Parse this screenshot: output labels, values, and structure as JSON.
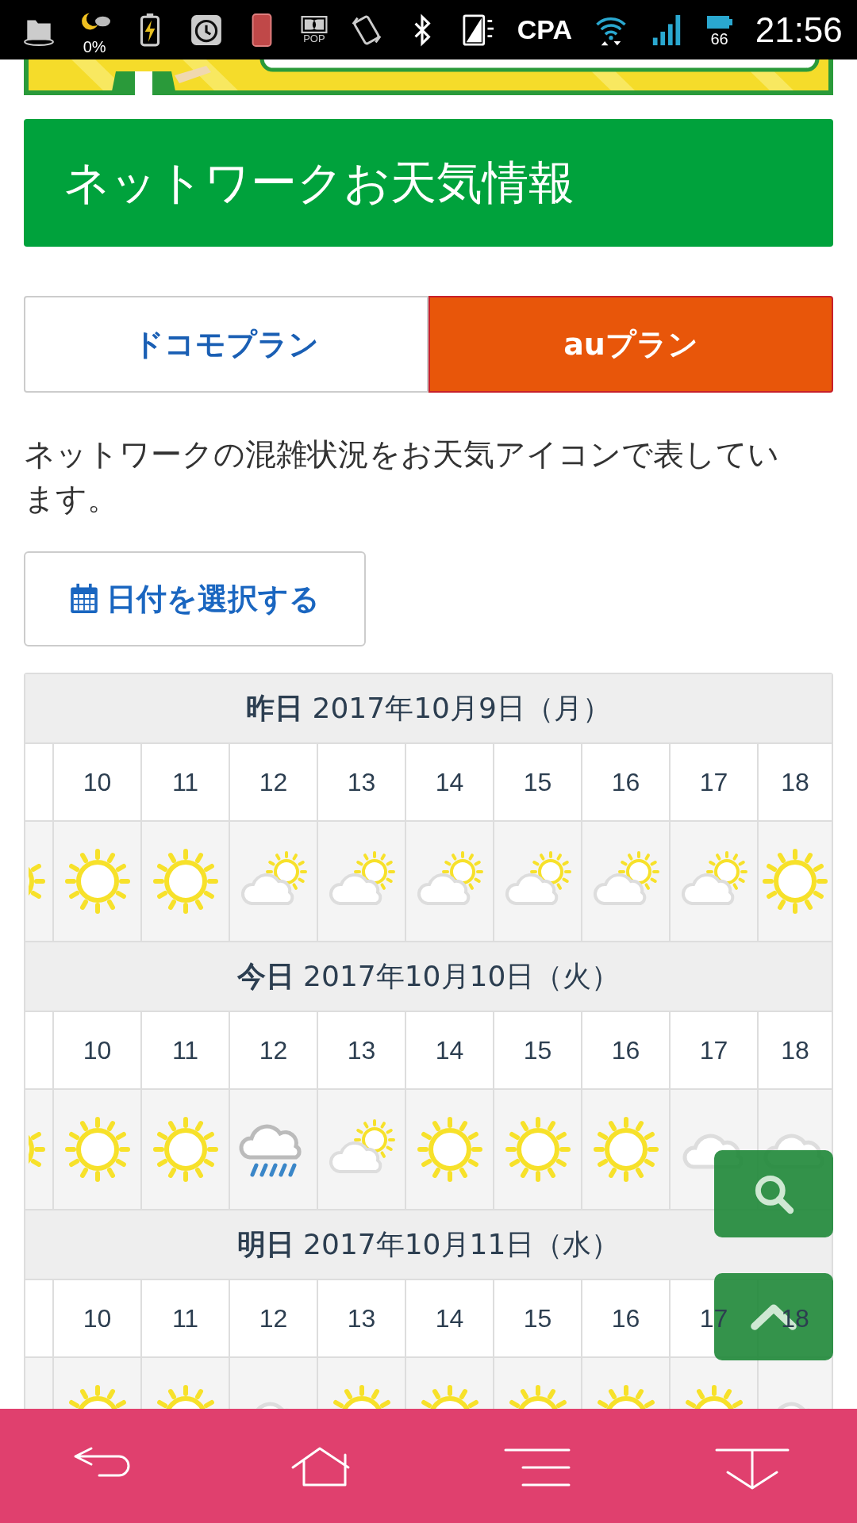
{
  "status_bar": {
    "weather_percent": "0%",
    "audio_label": "POP",
    "carrier": "CPA",
    "battery": "66",
    "time": "21:56"
  },
  "header": {
    "title": "ネットワークお天気情報"
  },
  "tabs": [
    {
      "label": "ドコモプラン",
      "selected": false
    },
    {
      "label": "auプラン",
      "selected": true
    }
  ],
  "description": "ネットワークの混雑状況をお天気アイコンで表しています。",
  "date_button": {
    "label": "日付を選択する"
  },
  "days": [
    {
      "heading": "**昨日** 2017年10月9日（月）",
      "hours": [
        "10",
        "11",
        "12",
        "13",
        "14",
        "15",
        "16",
        "17",
        "18"
      ],
      "weather": [
        {
          "kind": "sun"
        },
        {
          "kind": "sun"
        },
        {
          "kind": "sun"
        },
        {
          "kind": "partly"
        },
        {
          "kind": "partly"
        },
        {
          "kind": "partly"
        },
        {
          "kind": "partly"
        },
        {
          "kind": "partly"
        },
        {
          "kind": "partly"
        },
        {
          "kind": "sun"
        }
      ]
    },
    {
      "heading": "**今日** 2017年10月10日（火）",
      "hours": [
        "10",
        "11",
        "12",
        "13",
        "14",
        "15",
        "16",
        "17",
        "18"
      ],
      "weather": [
        {
          "kind": "sun"
        },
        {
          "kind": "sun"
        },
        {
          "kind": "sun"
        },
        {
          "kind": "rain"
        },
        {
          "kind": "partly"
        },
        {
          "kind": "sun"
        },
        {
          "kind": "sun"
        },
        {
          "kind": "sun"
        },
        {
          "kind": "cloud"
        },
        {
          "kind": "cloud"
        }
      ]
    },
    {
      "heading": "**明日** 2017年10月11日（水）",
      "hours": [
        "10",
        "11",
        "12",
        "13",
        "14",
        "15",
        "16",
        "17",
        "18"
      ],
      "weather": [
        {
          "kind": "sun"
        },
        {
          "kind": "sun"
        },
        {
          "kind": "cloud"
        },
        {
          "kind": "sun"
        },
        {
          "kind": "sun"
        },
        {
          "kind": "sun"
        },
        {
          "kind": "sun"
        },
        {
          "kind": "sun"
        },
        {
          "kind": "cloud"
        }
      ]
    }
  ],
  "floating_buttons": [
    {
      "kind": "search"
    },
    {
      "kind": "top"
    }
  ]
}
